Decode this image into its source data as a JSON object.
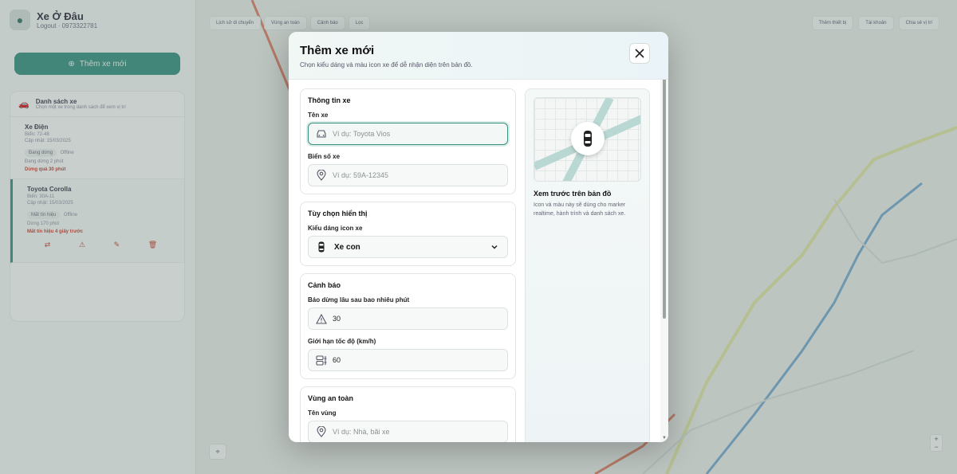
{
  "background": {
    "brand": {
      "title": "Xe Ở Đâu",
      "subtitle": "Logout · 0973322781"
    },
    "add_vehicle_label": "Thêm xe mới",
    "list": {
      "title": "Danh sách xe",
      "subtitle": "Chọn một xe trong danh sách để xem vị trí",
      "vehicles": [
        {
          "name": "Xe Điện",
          "line1": "Biển: 72-48",
          "line2": "Cập nhật: 15/03/2025",
          "tag": "Đang dừng",
          "tag2": "Offline",
          "status": "Đang dừng 2 phút",
          "warn": "Dừng quá 30 phút"
        },
        {
          "name": "Toyota Corolla",
          "line1": "Biển: 30A-11",
          "line2": "Cập nhật: 15/03/2025",
          "tag": "Mất tín hiệu",
          "tag2": "Offline",
          "status": "Dừng 170 phút",
          "warn": "Mất tín hiệu 4 giây trước"
        }
      ]
    },
    "toolbar": [
      "Lịch sử di chuyển",
      "Vùng an toàn",
      "Cảnh báo",
      "Lọc"
    ],
    "top_right": [
      "Thêm thiết bị",
      "Tài khoản",
      "Chia sẻ vị trí"
    ]
  },
  "modal": {
    "title": "Thêm xe mới",
    "subtitle": "Chọn kiểu dáng và màu icon xe để dễ nhận diện trên bản đồ.",
    "sections": {
      "vehicle_info": {
        "title": "Thông tin xe",
        "name_label": "Tên xe",
        "name_placeholder": "Ví dụ: Toyota Vios",
        "plate_label": "Biển số xe",
        "plate_placeholder": "Ví dụ: 59A-12345"
      },
      "display": {
        "title": "Tùy chọn hiển thị",
        "icon_style_label": "Kiểu dáng icon xe",
        "icon_style_value": "Xe con"
      },
      "alerts": {
        "title": "Cảnh báo",
        "stop_label": "Báo dừng lâu sau bao nhiêu phút",
        "stop_value": "30",
        "speed_label": "Giới hạn tốc độ (km/h)",
        "speed_value": "60"
      },
      "safe_zone": {
        "title": "Vùng an toàn",
        "zone_label": "Tên vùng",
        "zone_placeholder": "Ví dụ: Nhà, bãi xe"
      }
    },
    "preview": {
      "title": "Xem trước trên bản đồ",
      "description": "Icon và màu này sẽ dùng cho marker realtime, hành trình và danh sách xe."
    }
  },
  "colors": {
    "accent": "#2e8a79",
    "focus_border": "#3d8f83",
    "road": "#b9d8d3",
    "warn": "#c0392b"
  },
  "icons": [
    "car-icon",
    "location-pin-icon",
    "warning-triangle-icon",
    "speed-icon",
    "close-icon",
    "chevron-down-icon"
  ]
}
